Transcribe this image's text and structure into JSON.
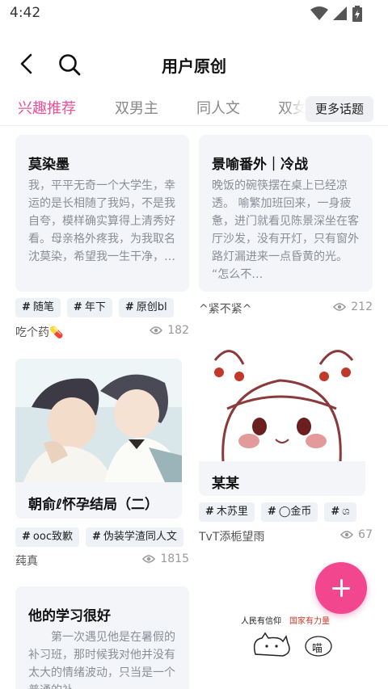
{
  "status_bar": {
    "time": "4:42"
  },
  "header": {
    "title": "用户原创"
  },
  "tabs": [
    {
      "label": "兴趣推荐",
      "active": true
    },
    {
      "label": "双男主",
      "active": false
    },
    {
      "label": "同人文",
      "active": false
    },
    {
      "label": "双女主",
      "active": false
    }
  ],
  "more_topics_label": "更多话题",
  "posts": [
    {
      "title": "莫染墨",
      "excerpt": "我，平平无奇一个大学生，幸运的是长相随了我妈，不是我自夸，模样确实算得上清秀好看。母亲格外疼我，为我取名沈莫染，希望我一生干净，…",
      "tags": [
        "随笔",
        "年下",
        "原创bl"
      ],
      "author": "吃个药💊",
      "views": "182"
    },
    {
      "title": "景喻番外｜冷战",
      "excerpt": "晚饭的碗筷摆在桌上已经凉透。 喻繁加班回来，一身疲惫，进门就看见陈景深坐在客厅沙发，没有开灯，只有窗外路灯漏进来一点昏黄的光。 “怎么不…",
      "tags": [],
      "author": "^紧不紧^",
      "views": "212"
    },
    {
      "title": "朝俞ℓ怀孕结局（二）",
      "excerpt": "",
      "tags": [
        "ooc致歉",
        "伪装学渣同人文"
      ],
      "author": "莼真",
      "views": "1815"
    },
    {
      "title": "某某",
      "excerpt": "",
      "tags": [
        "木苏里",
        "◯金币",
        "ශ"
      ],
      "author": "TvT添栀望雨",
      "views": "67"
    },
    {
      "title": "他的学习很好",
      "excerpt": "第一次遇见他是在暑假的补习班，那时候我对他并没有太大的情绪波动，只当是一个普通的补…",
      "tags": [],
      "author": "",
      "views": ""
    },
    {
      "title": "",
      "excerpt": "",
      "tags": [],
      "author": "",
      "views": "",
      "image_text_left": "人民有信仰",
      "image_text_right": "国家有力量",
      "image_bubble": "喵"
    }
  ],
  "colors": {
    "accent": "#ef4f97",
    "fab": "#f2468f"
  }
}
